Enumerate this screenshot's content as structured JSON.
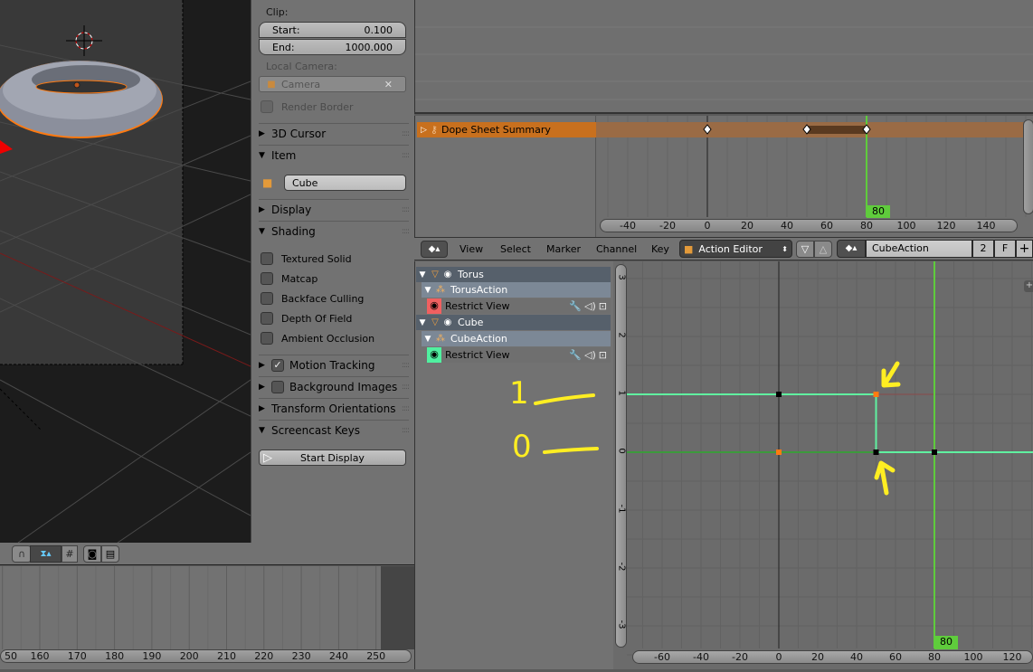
{
  "viewport": {
    "colors": {
      "camera_frame": "#393939",
      "background": "#1c1c1c",
      "selection": "#ff7a10"
    }
  },
  "properties": {
    "clip_label": "Clip:",
    "start_label": "Start:",
    "start_value": "0.100",
    "end_label": "End:",
    "end_value": "1000.000",
    "local_camera_label": "Local Camera:",
    "camera_value": "Camera",
    "render_border": "Render Border",
    "sections": {
      "cursor": "3D Cursor",
      "item": "Item",
      "display": "Display",
      "shading": "Shading",
      "motion_tracking": "Motion Tracking",
      "background_images": "Background Images",
      "transform_orientations": "Transform Orientations",
      "screencast_keys": "Screencast Keys"
    },
    "item_name": "Cube",
    "shading_options": [
      "Textured Solid",
      "Matcap",
      "Backface Culling",
      "Depth Of Field",
      "Ambient Occlusion"
    ],
    "motion_tracking_checked": true,
    "start_display": "Start Display"
  },
  "timeline": {
    "ticks": [
      "50",
      "160",
      "170",
      "180",
      "190",
      "200",
      "210",
      "220",
      "230",
      "240",
      "250"
    ]
  },
  "dopesheet": {
    "summary": "Dope Sheet Summary",
    "ticks": [
      "-40",
      "-20",
      "0",
      "20",
      "40",
      "60",
      "80",
      "100",
      "120",
      "140"
    ],
    "keyframes": [
      0,
      50,
      80
    ],
    "current_frame": "80",
    "colors": {
      "summary": "#c8701e",
      "current_frame": "#5fcc3c"
    }
  },
  "header": {
    "menus": [
      "View",
      "Select",
      "Marker",
      "Channel",
      "Key"
    ],
    "mode": "Action Editor",
    "action": "CubeAction",
    "users": "2",
    "fake_user": "F"
  },
  "graph": {
    "channels": [
      {
        "type": "object",
        "label": "Torus"
      },
      {
        "type": "action",
        "label": "TorusAction"
      },
      {
        "type": "fcurve",
        "label": "Restrict View",
        "color": "#f06060"
      },
      {
        "type": "object",
        "label": "Cube"
      },
      {
        "type": "action",
        "label": "CubeAction"
      },
      {
        "type": "fcurve",
        "label": "Restrict View",
        "color": "#50f0a0"
      }
    ],
    "x_ticks": [
      "-60",
      "-40",
      "-20",
      "0",
      "20",
      "40",
      "60",
      "80",
      "100",
      "120"
    ],
    "y_ticks": [
      "3",
      "2",
      "1",
      "0",
      "-1",
      "-2",
      "-3"
    ],
    "current_frame": "80",
    "curves": [
      {
        "color": "#60f0a0",
        "points": [
          [
            0,
            1
          ],
          [
            50,
            1
          ],
          [
            50,
            0
          ],
          [
            80,
            0
          ]
        ]
      },
      {
        "color": "#3c9a3c",
        "points": [
          [
            0,
            0
          ],
          [
            50,
            0
          ]
        ]
      }
    ],
    "annotations": [
      "1",
      "0"
    ],
    "annotation_color": "#ffee22"
  }
}
